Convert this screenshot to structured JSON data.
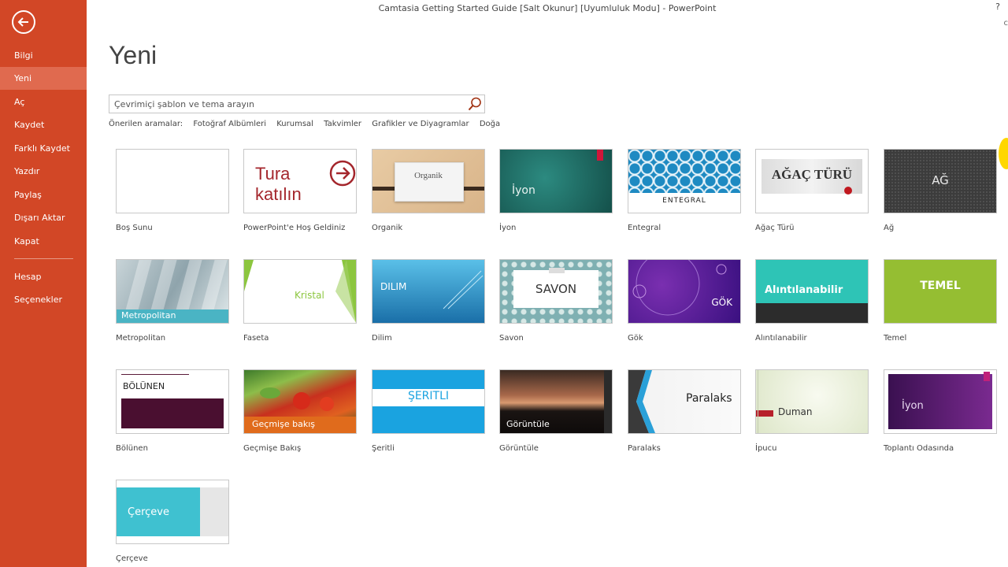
{
  "window": {
    "title": "Camtasia Getting Started Guide [Salt Okunur] [Uyumluluk Modu] - PowerPoint",
    "help": "?",
    "corner": "c"
  },
  "sidebar": {
    "items": [
      {
        "label": "Bilgi"
      },
      {
        "label": "Yeni"
      },
      {
        "label": "Aç"
      },
      {
        "label": "Kaydet"
      },
      {
        "label": "Farklı Kaydet"
      },
      {
        "label": "Yazdır"
      },
      {
        "label": "Paylaş"
      },
      {
        "label": "Dışarı Aktar"
      },
      {
        "label": "Kapat"
      },
      {
        "label": "Hesap"
      },
      {
        "label": "Seçenekler"
      }
    ]
  },
  "page": {
    "title": "Yeni"
  },
  "search": {
    "placeholder": "Çevrimiçi şablon ve tema arayın"
  },
  "suggested": {
    "label": "Önerilen aramalar:",
    "links": [
      "Fotoğraf Albümleri",
      "Kurumsal",
      "Takvimler",
      "Grafikler ve Diyagramlar",
      "Doğa"
    ]
  },
  "templates": [
    {
      "name": "Boş Sunu"
    },
    {
      "name": "PowerPoint'e Hoş Geldiniz",
      "t1": "Tura",
      "t2": "katılın"
    },
    {
      "name": "Organik",
      "t": "Organik"
    },
    {
      "name": "İyon",
      "t": "İyon"
    },
    {
      "name": "Entegral",
      "t": "ENTEGRAL"
    },
    {
      "name": "Ağaç Türü",
      "t": "AĞAÇ TÜRÜ"
    },
    {
      "name": "Ağ",
      "t": "AĞ"
    },
    {
      "name": "Metropolitan",
      "t": "Metropolitan"
    },
    {
      "name": "Faseta",
      "t": "Kristal"
    },
    {
      "name": "Dilim",
      "t": "DILIM"
    },
    {
      "name": "Savon",
      "t": "SAVON"
    },
    {
      "name": "Gök",
      "t": "GÖK"
    },
    {
      "name": "Alıntılanabilir",
      "t": "Alıntılanabilir"
    },
    {
      "name": "Temel",
      "t": "TEMEL"
    },
    {
      "name": "Bölünen",
      "t": "BÖLÜNEN"
    },
    {
      "name": "Geçmişe Bakış",
      "t": "Geçmişe bakış"
    },
    {
      "name": "Şeritli",
      "t": "ŞERITLI"
    },
    {
      "name": "Görüntüle",
      "t": "Görüntüle"
    },
    {
      "name": "Paralaks",
      "t": "Paralaks"
    },
    {
      "name": "İpucu",
      "t": "Duman"
    },
    {
      "name": "Toplantı Odasında",
      "t": "İyon"
    },
    {
      "name": "Çerçeve",
      "t": "Çerçeve"
    }
  ],
  "colors": {
    "accent": "#d24726",
    "active": "#e06a4f"
  }
}
